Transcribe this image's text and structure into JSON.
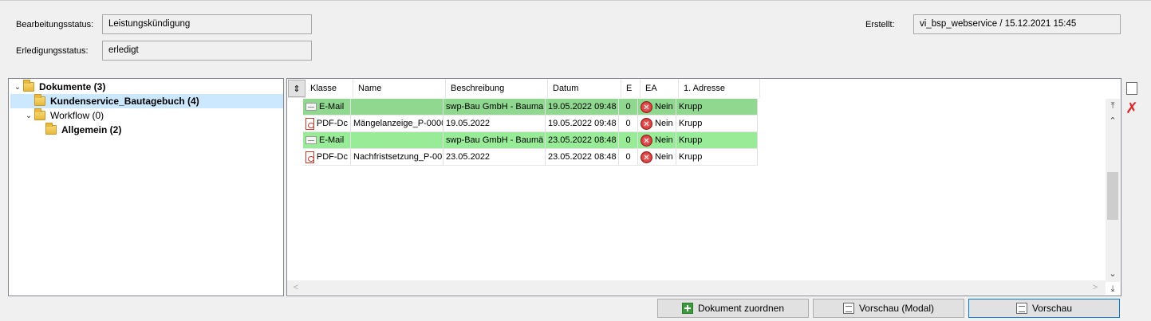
{
  "header": {
    "bearbeitungsstatus_label": "Bearbeitungsstatus:",
    "bearbeitungsstatus_value": "Leistungskündigung",
    "erledigungsstatus_label": "Erledigungsstatus:",
    "erledigungsstatus_value": "erledigt",
    "erstellt_label": "Erstellt:",
    "erstellt_value": "vi_bsp_webservice / 15.12.2021 15:45"
  },
  "tree": {
    "items": [
      {
        "label": "Dokumente (3)"
      },
      {
        "label": "Kundenservice_Bautagebuch (4)"
      },
      {
        "label": "Workflow (0)"
      },
      {
        "label": "Allgemein (2)"
      }
    ]
  },
  "grid": {
    "columns": [
      "Klasse",
      "Name",
      "Beschreibung",
      "Datum",
      "E",
      "EA",
      "1. Adresse"
    ],
    "rows": [
      {
        "klasse": "E-Mail",
        "name": "",
        "beschreibung": "swp-Bau GmbH - Bauma",
        "datum": "19.05.2022 09:48",
        "e": "0",
        "ea": "Nein",
        "adresse": "Krupp"
      },
      {
        "klasse": "PDF-Dc",
        "name": "Mängelanzeige_P-0000",
        "beschreibung": "19.05.2022",
        "datum": "19.05.2022 09:48",
        "e": "0",
        "ea": "Nein",
        "adresse": "Krupp"
      },
      {
        "klasse": "E-Mail",
        "name": "",
        "beschreibung": "swp-Bau GmbH - Baumä",
        "datum": "23.05.2022 08:48",
        "e": "0",
        "ea": "Nein",
        "adresse": "Krupp"
      },
      {
        "klasse": "PDF-Dc",
        "name": "Nachfristsetzung_P-00",
        "beschreibung": "23.05.2022",
        "datum": "23.05.2022 08:48",
        "e": "0",
        "ea": "Nein",
        "adresse": "Krupp"
      }
    ]
  },
  "buttons": {
    "zuordnen": "Dokument zuordnen",
    "vorschau_modal": "Vorschau (Modal)",
    "vorschau": "Vorschau"
  },
  "colors": {
    "row_selected_green": "#90d890",
    "row_green": "#98ec98",
    "tree_selection": "#cce8ff",
    "focus_border": "#0078d7"
  }
}
